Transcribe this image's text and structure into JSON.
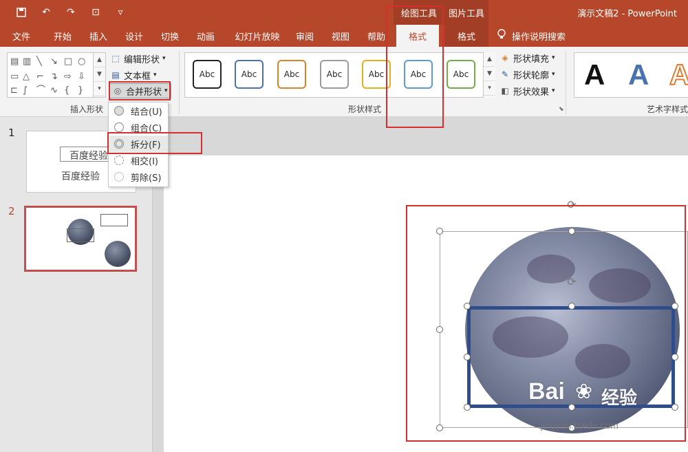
{
  "title_bar": {
    "context_drawing_tools": "绘图工具",
    "context_picture_tools": "图片工具",
    "doc_title": "演示文稿2 - PowerPoint"
  },
  "tabs": {
    "file": "文件",
    "home": "开始",
    "insert": "插入",
    "design": "设计",
    "transitions": "切换",
    "animations": "动画",
    "slideshow": "幻灯片放映",
    "review": "审阅",
    "view": "视图",
    "help": "帮助",
    "format_drawing": "格式",
    "format_picture": "格式",
    "tell_me": "操作说明搜索"
  },
  "ribbon": {
    "insert_shapes_label": "插入形状",
    "edit_shape": "编辑形状",
    "text_box": "文本框",
    "merge_shapes": "合并形状",
    "shape_styles_label": "形状样式",
    "style_sample": "Abc",
    "shape_fill": "形状填充",
    "shape_outline": "形状轮廓",
    "shape_effects": "形状效果",
    "wordart_label": "艺术字样式",
    "wordart_sample": "A"
  },
  "merge_menu": {
    "items": [
      "结合(U)",
      "组合(C)",
      "拆分(F)",
      "相交(I)",
      "剪除(S)"
    ],
    "highlighted": "拆分(F)"
  },
  "thumbnails": {
    "slide1_number": "1",
    "slide1_text_box": "百度经验",
    "slide1_text": "百度经验",
    "slide2_number": "2"
  },
  "watermark": {
    "brand": "Bai",
    "brand_suffix": "经验",
    "url": "jingyan.baidu.com"
  },
  "colors": {
    "accent": "#b7472a",
    "context_tab": "#a13e25",
    "annotation": "#d32f2f",
    "shape_outline": "#2f4d8a"
  }
}
